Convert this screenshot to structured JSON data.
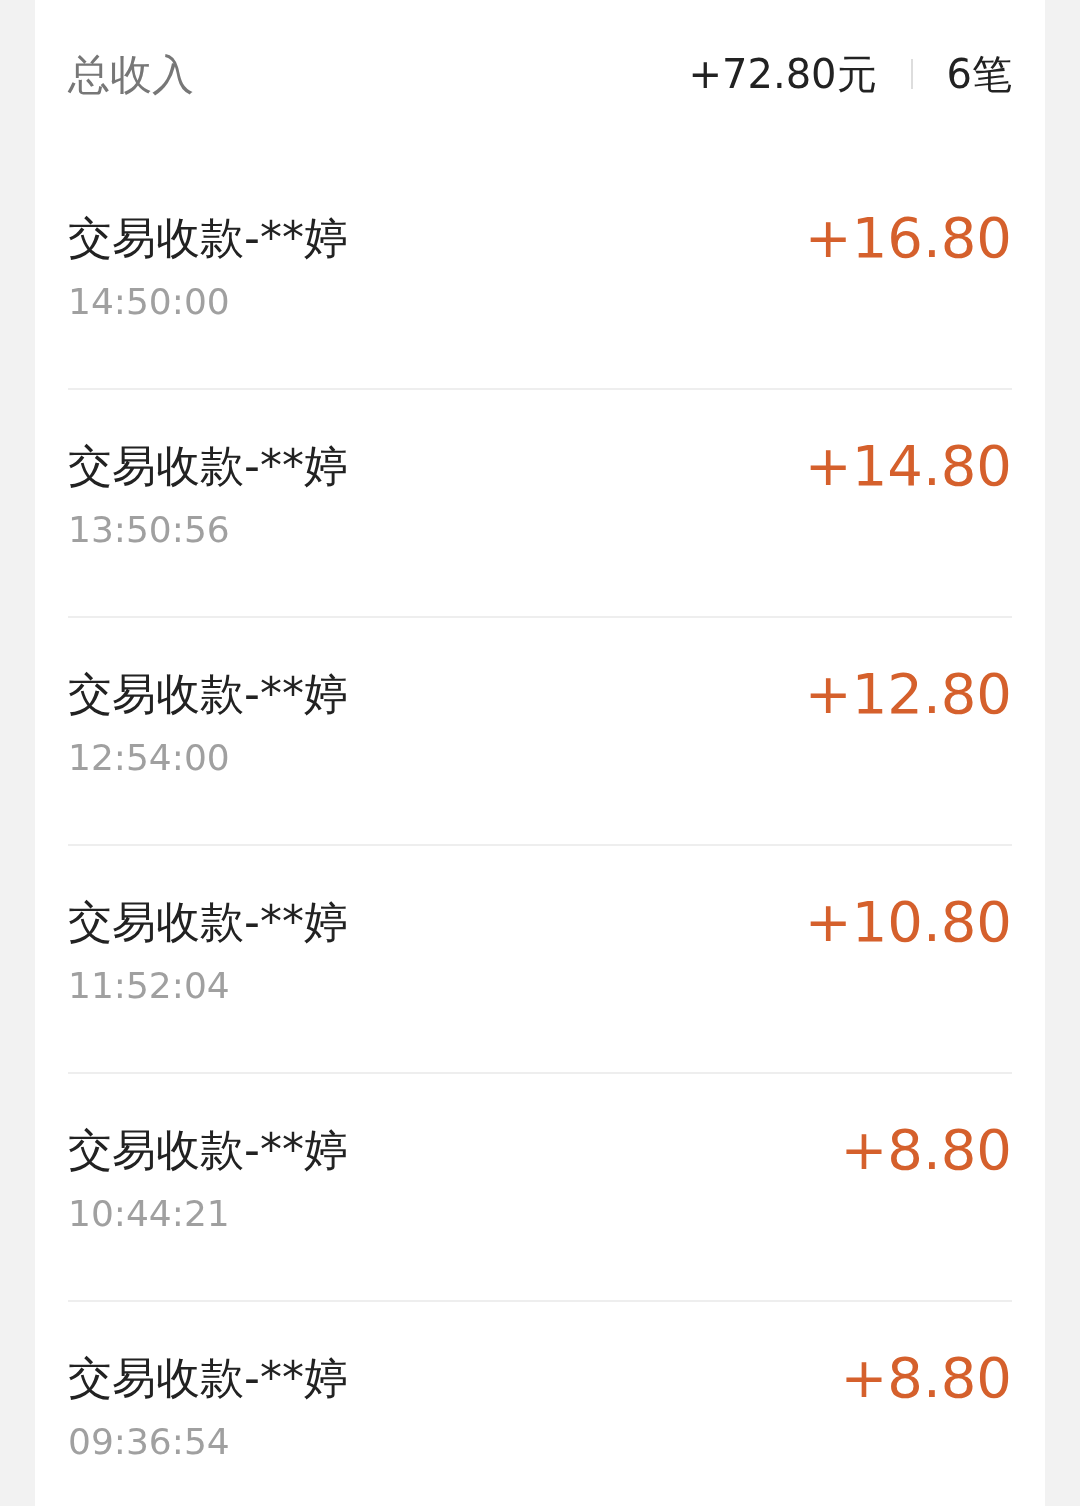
{
  "summary": {
    "label": "总收入",
    "total": "+72.80元",
    "count": "6笔"
  },
  "transactions": [
    {
      "title": "交易收款-**婷",
      "time": "14:50:00",
      "amount": "+16.80"
    },
    {
      "title": "交易收款-**婷",
      "time": "13:50:56",
      "amount": "+14.80"
    },
    {
      "title": "交易收款-**婷",
      "time": "12:54:00",
      "amount": "+12.80"
    },
    {
      "title": "交易收款-**婷",
      "time": "11:52:04",
      "amount": "+10.80"
    },
    {
      "title": "交易收款-**婷",
      "time": "10:44:21",
      "amount": "+8.80"
    },
    {
      "title": "交易收款-**婷",
      "time": "09:36:54",
      "amount": "+8.80"
    }
  ]
}
